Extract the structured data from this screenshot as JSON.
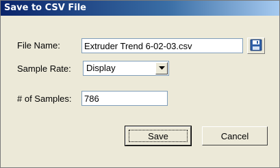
{
  "window": {
    "title": "Save to CSV File"
  },
  "form": {
    "file_name_label": "File Name:",
    "file_name_value": "Extruder Trend 6-02-03.csv",
    "sample_rate_label": "Sample Rate:",
    "sample_rate_value": "Display",
    "samples_label": "# of Samples:",
    "samples_value": "786"
  },
  "buttons": {
    "save": "Save",
    "cancel": "Cancel"
  },
  "icons": {
    "browse": "floppy-disk-icon",
    "dropdown": "chevron-down-icon"
  },
  "colors": {
    "titlebar_start": "#0a246a",
    "titlebar_end": "#a6caf0",
    "dialog_bg": "#ece9d8"
  }
}
